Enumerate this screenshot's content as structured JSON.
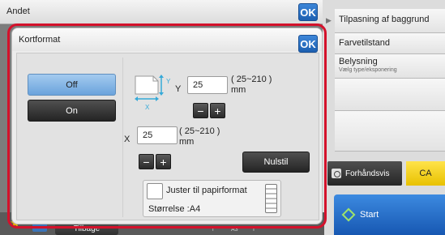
{
  "topbar": {
    "title": "Andet",
    "ok_label": "OK"
  },
  "right_panel": {
    "items": [
      {
        "label": "Tilpasning af baggrund",
        "sub": ""
      },
      {
        "label": "Farvetilstand",
        "sub": ""
      },
      {
        "label": "Belysning",
        "sub": "Vælg type/eksponering"
      }
    ],
    "preview_label": "Forhåndsvis",
    "ca_label": "CA",
    "start_label": "Start"
  },
  "bottom": {
    "back_label": "Tilbage",
    "marks": [
      "i",
      "A3",
      "I"
    ]
  },
  "dialog": {
    "title": "Kortformat",
    "ok_label": "OK",
    "off_label": "Off",
    "on_label": "On",
    "selected": "Off",
    "y": {
      "axis_label": "Y",
      "value": "25",
      "range": "( 25~210 )",
      "unit": "mm"
    },
    "x": {
      "axis_label": "X",
      "value": "25",
      "range": "( 25~210 )",
      "unit": "mm"
    },
    "minus": "−",
    "plus": "+",
    "reset_label": "Nulstil",
    "fit": {
      "label": "Juster til papirformat",
      "size_text": "Størrelse  :A4",
      "checked": false
    }
  },
  "colors": {
    "focus_ring": "#d4112b",
    "ok_blue": "#1d5fb0",
    "selected_toggle": "#6aa3dc",
    "ca_yellow": "#f1cf1a",
    "start_blue": "#1e63bd"
  }
}
